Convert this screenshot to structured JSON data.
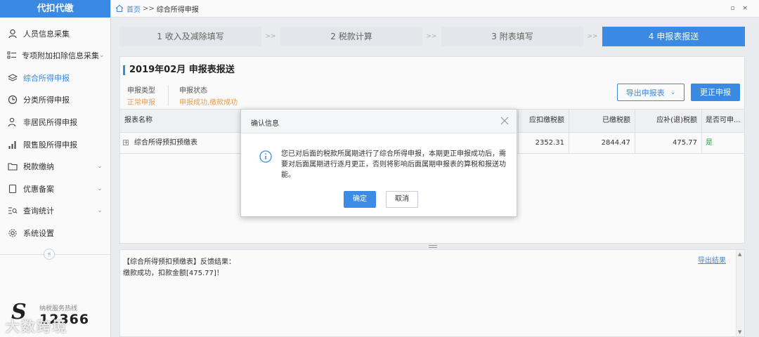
{
  "app": {
    "title": "代扣代缴"
  },
  "sidebar": {
    "items": [
      {
        "label": "人员信息采集",
        "icon": "person-icon",
        "has_chevron": false
      },
      {
        "label": "专项附加扣除信息采集",
        "icon": "list-icon",
        "has_chevron": true
      },
      {
        "label": "综合所得申报",
        "icon": "layers-icon",
        "has_chevron": false,
        "active": true
      },
      {
        "label": "分类所得申报",
        "icon": "clock-icon",
        "has_chevron": false
      },
      {
        "label": "非居民所得申报",
        "icon": "person-outline-icon",
        "has_chevron": false
      },
      {
        "label": "限售股所得申报",
        "icon": "bar-chart-icon",
        "has_chevron": false
      },
      {
        "label": "税款缴纳",
        "icon": "folder-icon",
        "has_chevron": true
      },
      {
        "label": "优惠备案",
        "icon": "document-icon",
        "has_chevron": true
      },
      {
        "label": "查询统计",
        "icon": "query-icon",
        "has_chevron": true
      },
      {
        "label": "系统设置",
        "icon": "gear-icon",
        "has_chevron": false
      }
    ],
    "collapse_glyph": "«",
    "hotline_label": "纳税服务热线",
    "hotline_number": "12366",
    "watermark": "大数跨境"
  },
  "breadcrumb": {
    "home": "首页",
    "separator": ">>",
    "current": "综合所得申报"
  },
  "window_buttons": "▫ ×",
  "steps": [
    {
      "label": "1 收入及减除填写",
      "active": false
    },
    {
      "label": "2 税款计算",
      "active": false
    },
    {
      "label": "3 附表填写",
      "active": false
    },
    {
      "label": "4 申报表报送",
      "active": true
    }
  ],
  "step_arrow": ">>",
  "panel": {
    "title": "2019年02月  申报表报送",
    "type_label": "申报类型",
    "type_value": "正常申报",
    "status_label": "申报状态",
    "status_value": "申报成功,缴款成功",
    "export_button": "导出申报表",
    "correct_button": "更正申报"
  },
  "table": {
    "headers": [
      "报表名称",
      "应扣缴税额",
      "已缴税额",
      "应补(退)税额",
      "是否可申..."
    ],
    "rows": [
      {
        "name": "综合所得预扣预缴表",
        "due": "2352.31",
        "paid": "2844.47",
        "refund": "475.77",
        "can_declare": "是"
      }
    ]
  },
  "feedback": {
    "title_line": "【综合所得预扣预缴表】反馈结果：",
    "result_line": "缴款成功，扣款金额[475.77]！",
    "export_link": "导出结果"
  },
  "dialog": {
    "title": "确认信息",
    "message": "您已对后面的税款所属期进行了综合所得申报，本期更正申报成功后，需要对后面属期进行逐月更正，否则将影响后面属期申报表的算税和报送功能。",
    "ok": "确定",
    "cancel": "取消"
  },
  "colors": {
    "accent": "#3c8ce7",
    "warning": "#f0a050",
    "success": "#2aa34a"
  }
}
